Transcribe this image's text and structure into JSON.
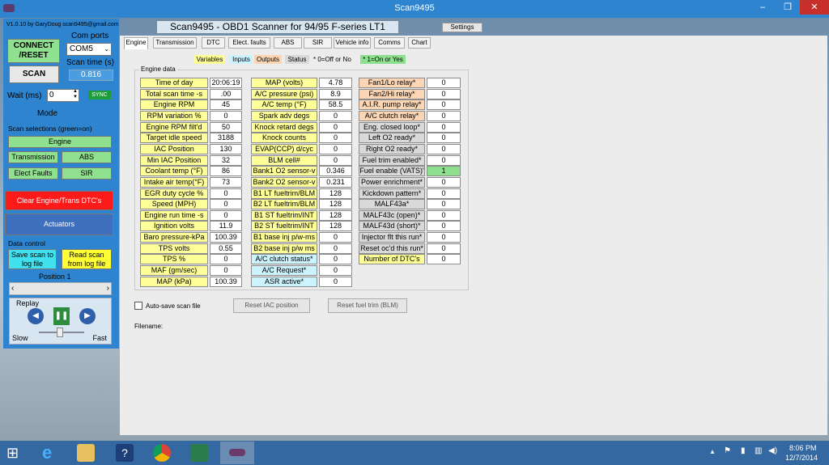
{
  "window": {
    "title": "Scan9495",
    "min": "–",
    "max": "❐",
    "close": "✕"
  },
  "left": {
    "version": "V1.0.10 by GaryDoug scan9495@gmail.com",
    "connect_label": "CONNECT\n/RESET",
    "com_ports_label": "Com ports",
    "com_value": "COM5",
    "scan_label": "SCAN",
    "scan_time_label": "Scan time (s)",
    "scan_time_value": "0.816",
    "wait_label": "Wait (ms)",
    "wait_value": "0",
    "sync_label": "SYNC",
    "mode_label": "Mode",
    "scan_sel_label": "Scan selections (green=on)",
    "engine_btn": "Engine",
    "transmission_btn": "Transmission",
    "abs_btn": "ABS",
    "elect_faults_btn": "Elect Faults",
    "sir_btn": "SIR",
    "clear_dtc_btn": "Clear Engine/Trans DTC's",
    "actuators_btn": "Actuators",
    "data_control_label": "Data control",
    "save_scan_btn": "Save scan to log file",
    "read_scan_btn": "Read scan from log file",
    "position_label": "Position  1",
    "replay_label": "Replay",
    "slow_label": "Slow",
    "fast_label": "Fast"
  },
  "header": {
    "app_title": "Scan9495 - OBD1 Scanner for 94/95 F-series LT1",
    "settings_btn": "Settings"
  },
  "tabs": [
    "Engine",
    "Transmission",
    "DTC",
    "Elect. faults",
    "ABS",
    "SIR",
    "Vehicle info",
    "Comms",
    "Chart"
  ],
  "legend": {
    "variables": "Variables",
    "inputs": "Inputs",
    "outputs": "Outputs",
    "status": "Status",
    "off_note": "* 0=Off or No",
    "on_note": "* 1=On or Yes"
  },
  "engine_data_label": "Engine data",
  "col1": [
    {
      "label": "Time of day",
      "value": "20:06:19"
    },
    {
      "label": "Total scan time -s",
      "value": ".00"
    },
    {
      "label": "Engine RPM",
      "value": "45"
    },
    {
      "label": "RPM variation %",
      "value": "0"
    },
    {
      "label": "Engine RPM filt'd",
      "value": "50"
    },
    {
      "label": "Target idle speed",
      "value": "3188"
    },
    {
      "label": "IAC Position",
      "value": "130"
    },
    {
      "label": "Min IAC Position",
      "value": "32"
    },
    {
      "label": "Coolant temp (°F)",
      "value": "86"
    },
    {
      "label": "Intake air temp(°F)",
      "value": "73"
    },
    {
      "label": "EGR duty cycle %",
      "value": "0"
    },
    {
      "label": "Speed (MPH)",
      "value": "0"
    },
    {
      "label": "Engine run time -s",
      "value": "0"
    },
    {
      "label": "Ignition volts",
      "value": "11.9"
    },
    {
      "label": "Baro pressure-kPa",
      "value": "100.39"
    },
    {
      "label": "TPS volts",
      "value": "0.55"
    },
    {
      "label": "TPS %",
      "value": "0"
    },
    {
      "label": "MAF (gm/sec)",
      "value": "0"
    },
    {
      "label": "MAP (kPa)",
      "value": "100.39"
    }
  ],
  "col2": [
    {
      "label": "MAP (volts)",
      "value": "4.78"
    },
    {
      "label": "A/C pressure (psi)",
      "value": "8.9"
    },
    {
      "label": "A/C temp (°F)",
      "value": "58.5"
    },
    {
      "label": "Spark adv degs",
      "value": "0"
    },
    {
      "label": "Knock retard degs",
      "value": "0"
    },
    {
      "label": "Knock counts",
      "value": "0"
    },
    {
      "label": "EVAP(CCP) d/cyc",
      "value": "0"
    },
    {
      "label": "BLM cell#",
      "value": "0"
    },
    {
      "label": "Bank1 O2 sensor-v",
      "value": "0.346"
    },
    {
      "label": "Bank2 O2 sensor-v",
      "value": "0.231"
    },
    {
      "label": "B1 LT fueltrim/BLM",
      "value": "128"
    },
    {
      "label": "B2 LT fueltrim/BLM",
      "value": "128"
    },
    {
      "label": "B1 ST fueltrim/INT",
      "value": "128"
    },
    {
      "label": "B2 ST fueltrim/INT",
      "value": "128"
    },
    {
      "label": "B1 base inj p/w-ms",
      "value": "0"
    },
    {
      "label": "B2 base inj p/w ms",
      "value": "0"
    },
    {
      "label": "A/C clutch status*",
      "value": "0"
    },
    {
      "label": "A/C Request*",
      "value": "0"
    },
    {
      "label": "ASR active*",
      "value": "0"
    }
  ],
  "col3": [
    {
      "label": "Fan1/Lo relay*",
      "value": "0"
    },
    {
      "label": "Fan2/Hi relay*",
      "value": "0"
    },
    {
      "label": "A.I.R. pump relay*",
      "value": "0"
    },
    {
      "label": "A/C clutch relay*",
      "value": "0"
    },
    {
      "label": "Eng. closed loop*",
      "value": "0"
    },
    {
      "label": "Left O2 ready*",
      "value": "0"
    },
    {
      "label": "Right O2 ready*",
      "value": "0"
    },
    {
      "label": "Fuel trim enabled*",
      "value": "0"
    },
    {
      "label": "Fuel enable (VATS)'",
      "value": "1"
    },
    {
      "label": "Power enrichment*",
      "value": "0"
    },
    {
      "label": "Kickdown pattern*",
      "value": "0"
    },
    {
      "label": "MALF43a*",
      "value": "0"
    },
    {
      "label": "MALF43c (open)*",
      "value": "0"
    },
    {
      "label": "MALF43d (short)*",
      "value": "0"
    },
    {
      "label": "Injector flt this run*",
      "value": "0"
    },
    {
      "label": "Reset oc'd this run*",
      "value": "0"
    },
    {
      "label": "Number of DTC's",
      "value": "0"
    }
  ],
  "bottom": {
    "autosave_label": "Auto-save scan file",
    "reset_iac_btn": "Reset IAC position",
    "reset_fuel_btn": "Reset fuel trim (BLM)",
    "filename_label": "Filename:"
  },
  "taskbar": {
    "time": "8:06 PM",
    "date": "12/7/2014"
  }
}
